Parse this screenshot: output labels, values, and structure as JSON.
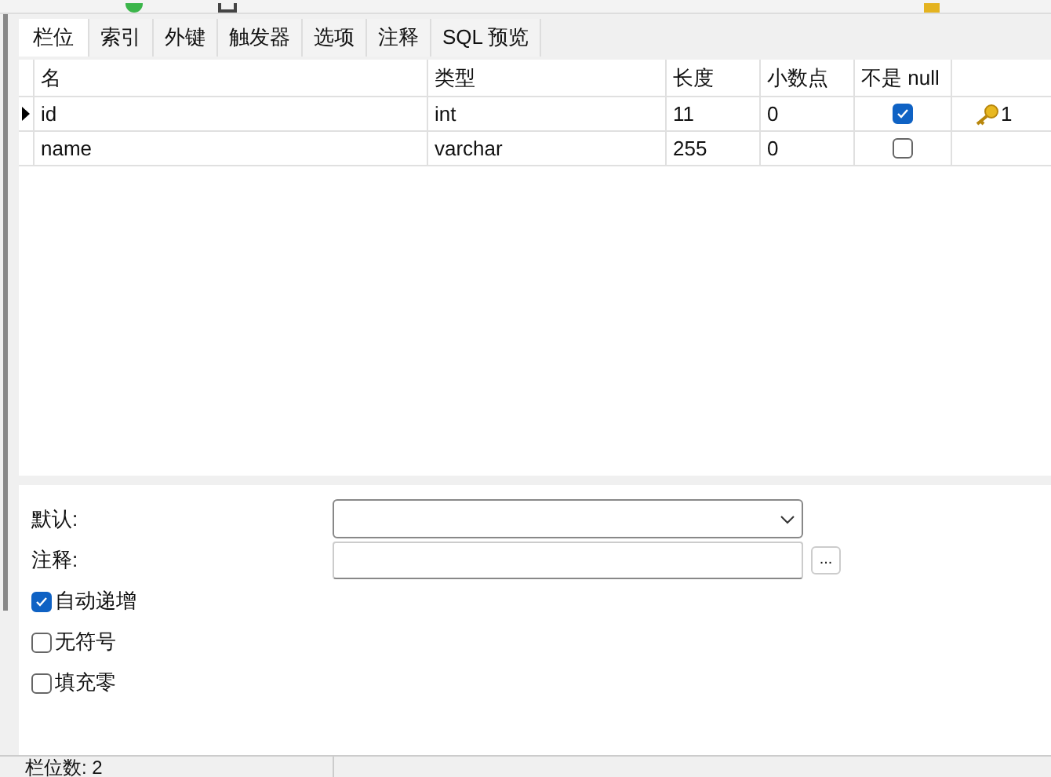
{
  "tabs": [
    {
      "label": "栏位",
      "selected": true
    },
    {
      "label": "索引",
      "selected": false
    },
    {
      "label": "外键",
      "selected": false
    },
    {
      "label": "触发器",
      "selected": false
    },
    {
      "label": "选项",
      "selected": false
    },
    {
      "label": "注释",
      "selected": false
    },
    {
      "label": "SQL 预览",
      "selected": false
    }
  ],
  "table": {
    "columns": [
      "名",
      "类型",
      "长度",
      "小数点",
      "不是 null"
    ],
    "rows": [
      {
        "name": "id",
        "type": "int",
        "length": "11",
        "decimals": "0",
        "not_null": true,
        "key": "1",
        "selected": true
      },
      {
        "name": "name",
        "type": "varchar",
        "length": "255",
        "decimals": "0",
        "not_null": false,
        "selected": false
      }
    ]
  },
  "form": {
    "default_label": "默认:",
    "comment_label": "注释:",
    "comment_button": "...",
    "options": [
      {
        "label": "自动递增",
        "checked": true
      },
      {
        "label": "无符号",
        "checked": false
      },
      {
        "label": "填充零",
        "checked": false
      }
    ]
  },
  "status_bar": "栏位数: 2"
}
